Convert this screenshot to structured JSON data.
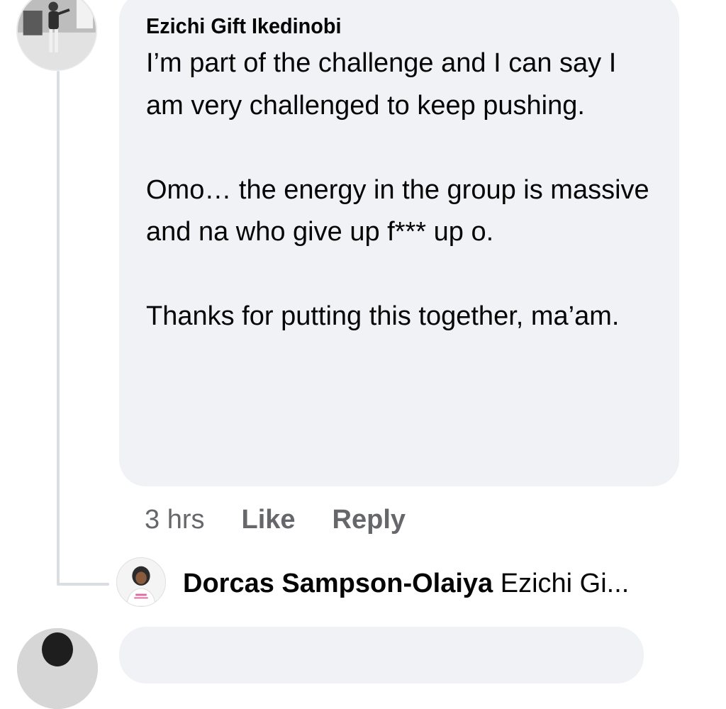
{
  "comment": {
    "author": "Ezichi Gift Ikedinobi",
    "paragraphs": [
      "I’m part of the challenge and I can say I am very challenged to keep pushing.",
      "Omo… the energy in the group is massive and na who give up f*** up o.",
      "Thanks for putting this together, ma’am."
    ],
    "time": "3 hrs",
    "like_label": "Like",
    "reply_label": "Reply"
  },
  "reply_preview": {
    "author": "Dorcas Sampson-Olaiya",
    "snippet": "Ezichi Gi..."
  },
  "colors": {
    "bubble_bg": "#f0f2f5",
    "meta_text": "#65676b",
    "body_text": "#050505",
    "thread_line": "#dadde1"
  },
  "icons": {
    "commenter_avatar": "profile-photo",
    "reply_avatar": "profile-photo"
  }
}
